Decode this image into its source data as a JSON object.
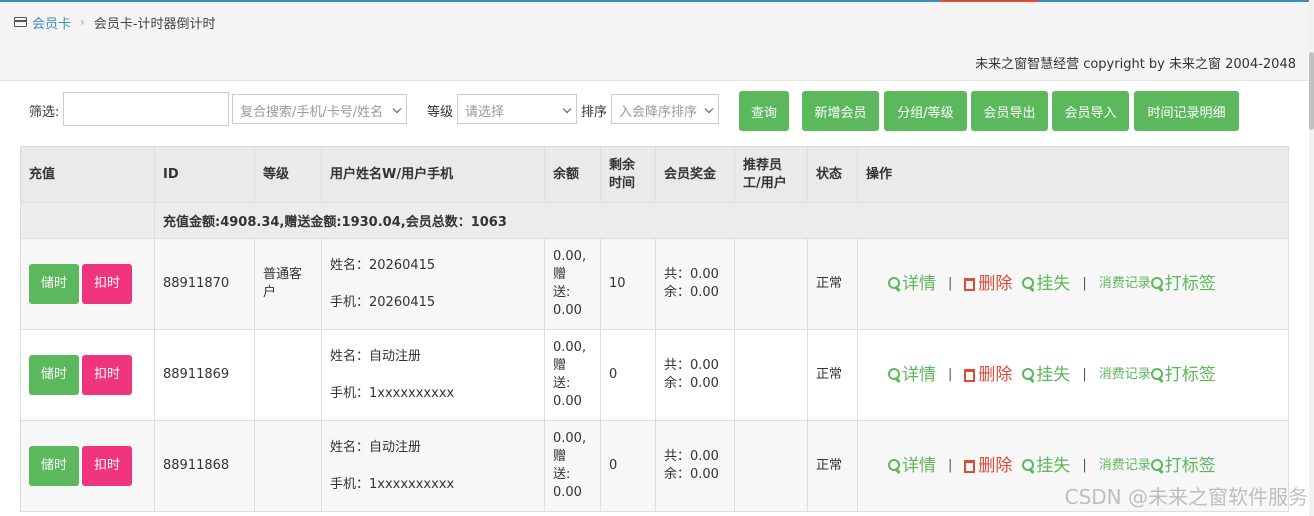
{
  "breadcrumb": {
    "root": "会员卡",
    "current": "会员卡-计时器倒计时"
  },
  "copyright": "未来之窗智慧经营 copyright by 未来之窗 2004-2048",
  "filters": {
    "filter_label": "筛选:",
    "search_placeholder": "复合搜索/手机/卡号/姓名",
    "level_label": "等级",
    "level_placeholder": "请选择",
    "sort_label": "排序",
    "sort_value": "入会降序排序"
  },
  "buttons": {
    "query": "查询",
    "add_member": "新增会员",
    "group_level": "分组/等级",
    "export": "会员导出",
    "import": "会员导入",
    "time_records": "时间记录明细"
  },
  "table": {
    "headers": {
      "recharge": "充值",
      "id": "ID",
      "level": "等级",
      "user": "用户姓名W/用户手机",
      "balance": "余额",
      "remaining_1": "剩余",
      "remaining_2": "时间",
      "bonus": "会员奖金",
      "referrer_1": "推荐员",
      "referrer_2": "工/用户",
      "status": "状态",
      "ops": "操作"
    },
    "summary": "充值金额:4908.34,赠送金额:1930.04,会员总数：1063",
    "row_buttons": {
      "store": "储时",
      "deduct": "扣时"
    },
    "actions": {
      "detail": "详情",
      "delete": "删除",
      "lost": "挂失",
      "sep": "|",
      "records": "消费记录",
      "tag": "打标签"
    },
    "rows": [
      {
        "id": "88911870",
        "level": "普通客户",
        "name": "姓名：20260415",
        "phone": "手机：20260415",
        "balance_1": "0.00,",
        "balance_2": "赠",
        "balance_3": "送:",
        "balance_4": "0.00",
        "remaining": "10",
        "bonus_total": "共：0.00",
        "bonus_left": "余：0.00",
        "status": "正常"
      },
      {
        "id": "88911869",
        "level": "",
        "name": "姓名：自动注册",
        "phone": "手机：1xxxxxxxxxx",
        "balance_1": "0.00,",
        "balance_2": "赠",
        "balance_3": "送:",
        "balance_4": "0.00",
        "remaining": "0",
        "bonus_total": "共：0.00",
        "bonus_left": "余：0.00",
        "status": "正常"
      },
      {
        "id": "88911868",
        "level": "",
        "name": "姓名：自动注册",
        "phone": "手机：1xxxxxxxxxx",
        "balance_1": "0.00,",
        "balance_2": "赠",
        "balance_3": "送:",
        "balance_4": "0.00",
        "remaining": "0",
        "bonus_total": "共：0.00",
        "bonus_left": "余：0.00",
        "status": "正常"
      }
    ]
  },
  "watermark": "CSDN @未来之窗软件服务"
}
